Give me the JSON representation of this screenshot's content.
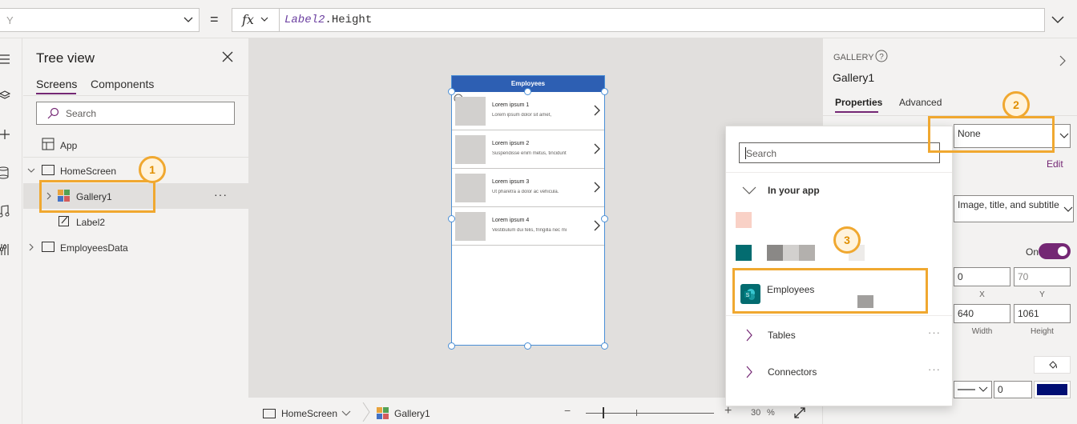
{
  "formula_bar": {
    "property": "Y",
    "equals": "=",
    "fx": "fx",
    "formula_object": "Label2",
    "formula_rest": ".Height"
  },
  "tree": {
    "title": "Tree view",
    "tabs": [
      "Screens",
      "Components"
    ],
    "search_placeholder": "Search",
    "items": [
      {
        "label": "App"
      },
      {
        "label": "HomeScreen"
      },
      {
        "label": "Gallery1"
      },
      {
        "label": "Label2"
      },
      {
        "label": "EmployeesData"
      }
    ],
    "more": "···"
  },
  "canvas": {
    "header": "Employees",
    "gallery_items": [
      {
        "title": "Lorem ipsum 1",
        "subtitle": "Lorem ipsum dolor sit amet,"
      },
      {
        "title": "Lorem ipsum 2",
        "subtitle": "Suspendisse enim metus, tincidunt"
      },
      {
        "title": "Lorem ipsum 3",
        "subtitle": "Ut pharetra a dolor ac vehicula."
      },
      {
        "title": "Lorem ipsum 4",
        "subtitle": "Vestibulum dui felis, fringilla nec mi"
      }
    ]
  },
  "status_bar": {
    "screen": "HomeScreen",
    "control": "Gallery1",
    "zoom_minus": "−",
    "zoom_plus": "+",
    "zoom_value": "30",
    "zoom_unit": "%"
  },
  "props": {
    "type": "GALLERY",
    "name": "Gallery1",
    "tabs": [
      "Properties",
      "Advanced"
    ],
    "data_source": "None",
    "edit": "Edit",
    "layout": "Image, title, and subtitle",
    "toggle_label": "On",
    "x": "0",
    "y": "70",
    "x_caption": "X",
    "y_caption": "Y",
    "width": "640",
    "height": "1061",
    "width_caption": "Width",
    "height_caption": "Height",
    "border_width": "0"
  },
  "flyout": {
    "search_placeholder": "Search",
    "section": "In your app",
    "employees": "Employees",
    "tables": "Tables",
    "connectors": "Connectors",
    "more": "···"
  },
  "callouts": [
    "1",
    "2",
    "3"
  ],
  "colors": {
    "accent": "#742774",
    "callout": "#f0a830",
    "header_blue": "#2d5fb3",
    "sharepoint_teal": "#036c70"
  }
}
